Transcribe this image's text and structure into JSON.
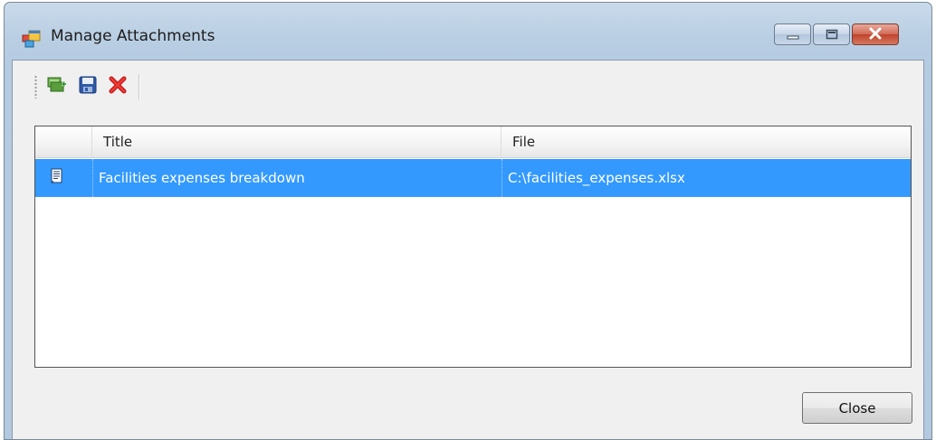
{
  "window": {
    "title": "Manage Attachments",
    "caption_buttons": [
      "minimize",
      "maximize",
      "close"
    ]
  },
  "toolbar": {
    "items": [
      {
        "icon": "add-attachment-icon"
      },
      {
        "icon": "save-icon"
      },
      {
        "icon": "delete-icon"
      }
    ]
  },
  "grid": {
    "columns": [
      "",
      "Title",
      "File"
    ],
    "rows": [
      {
        "icon": "document-icon",
        "title": "Facilities expenses breakdown",
        "file": "C:\\facilities_expenses.xlsx",
        "selected": true
      }
    ],
    "selection_color": "#3399ff"
  },
  "footer": {
    "close_label": "Close"
  }
}
